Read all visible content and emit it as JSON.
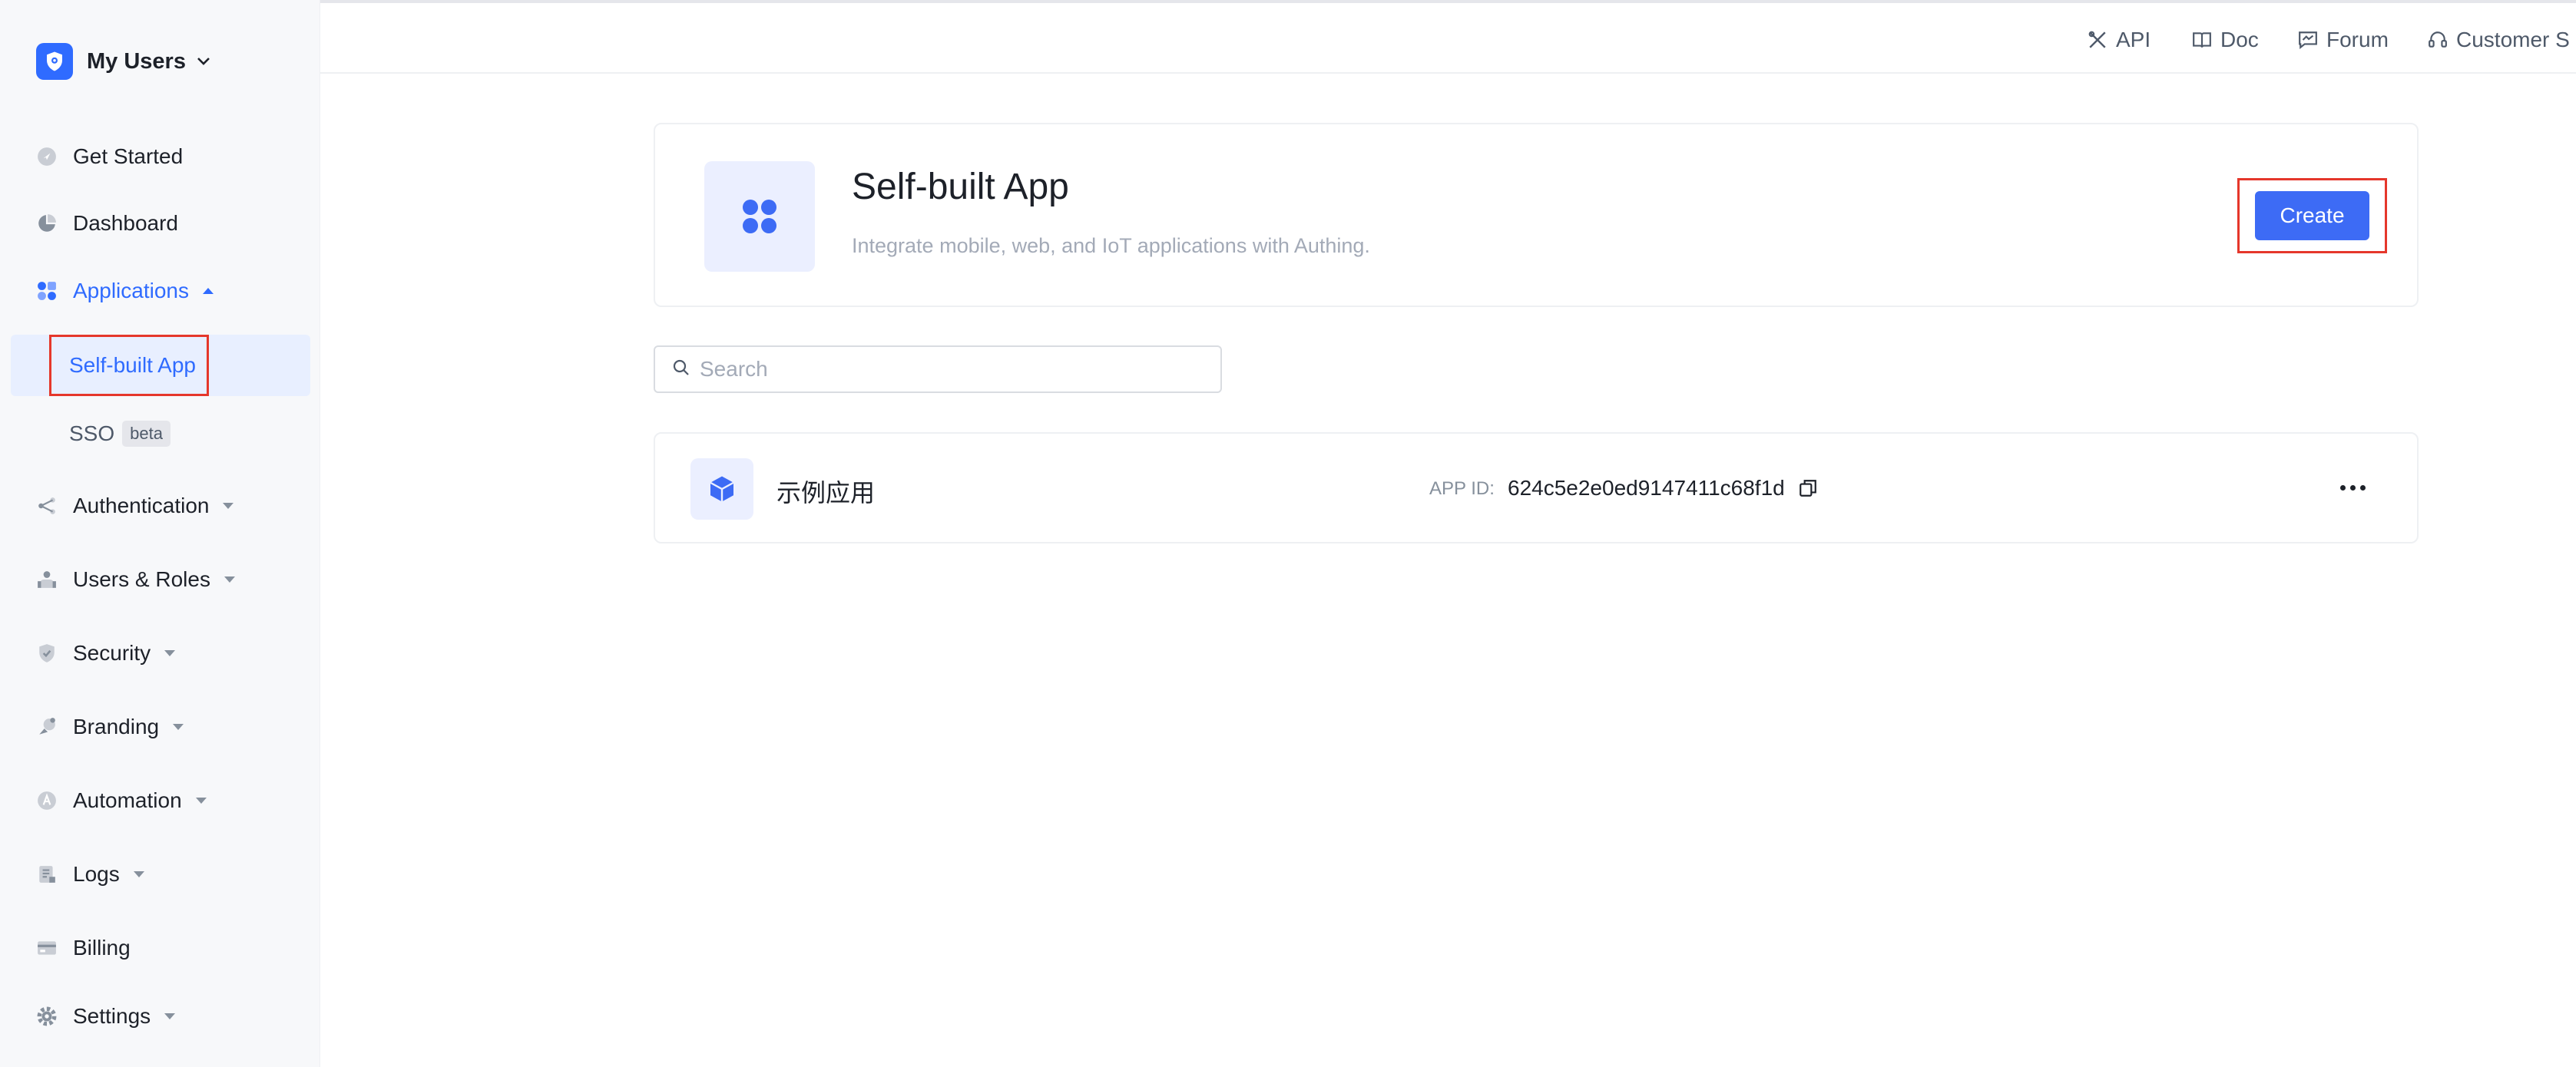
{
  "brand": {
    "name": "My Users"
  },
  "sidebar": {
    "items": [
      {
        "label": "Get Started",
        "icon": "rocket-icon"
      },
      {
        "label": "Dashboard",
        "icon": "pie-chart-icon"
      },
      {
        "label": "Applications",
        "icon": "apps-icon",
        "active": true
      },
      {
        "label": "Authentication",
        "icon": "share-icon"
      },
      {
        "label": "Users & Roles",
        "icon": "users-icon"
      },
      {
        "label": "Security",
        "icon": "shield-icon"
      },
      {
        "label": "Branding",
        "icon": "palette-icon"
      },
      {
        "label": "Automation",
        "icon": "automation-icon"
      },
      {
        "label": "Logs",
        "icon": "document-icon"
      },
      {
        "label": "Billing",
        "icon": "card-icon"
      },
      {
        "label": "Settings",
        "icon": "gear-icon"
      }
    ],
    "subitems": [
      {
        "label": "Self-built App",
        "active": true
      },
      {
        "label": "SSO",
        "badge": "beta"
      }
    ]
  },
  "topbar": {
    "links": [
      {
        "label": "API",
        "icon": "tools-icon"
      },
      {
        "label": "Doc",
        "icon": "book-icon"
      },
      {
        "label": "Forum",
        "icon": "chat-icon"
      },
      {
        "label": "Customer S",
        "icon": "headset-icon"
      }
    ]
  },
  "header_card": {
    "title": "Self-built App",
    "description": "Integrate mobile, web, and IoT applications with Authing.",
    "create_label": "Create"
  },
  "search": {
    "placeholder": "Search"
  },
  "apps": [
    {
      "name": "示例应用",
      "id_label": "APP ID:",
      "id_value": "624c5e2e0ed9147411c68f1d"
    }
  ],
  "colors": {
    "accent": "#3d6bf5",
    "highlight": "#e5372b",
    "selected_bg": "#e8efff"
  }
}
